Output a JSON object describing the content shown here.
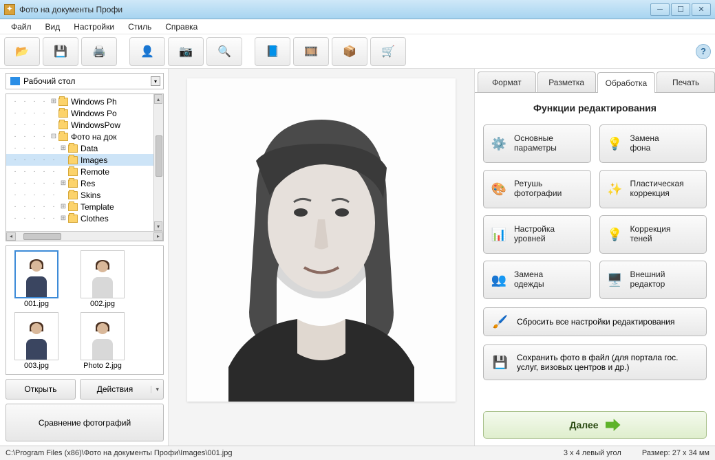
{
  "window": {
    "title": "Фото на документы Профи"
  },
  "menu": {
    "file": "Файл",
    "view": "Вид",
    "settings": "Настройки",
    "style": "Стиль",
    "help": "Справка"
  },
  "toolbar": {
    "new": "new-doc",
    "save": "save",
    "print": "print",
    "profile": "profile",
    "camera": "camera",
    "zoom": "zoom",
    "book": "book",
    "film": "film",
    "box": "box",
    "cart": "cart",
    "help": "?"
  },
  "left": {
    "combo_label": "Рабочий стол",
    "tree": [
      {
        "indent": 5,
        "exp": "⊞",
        "label": "Windows Ph"
      },
      {
        "indent": 5,
        "exp": "",
        "label": "Windows Po"
      },
      {
        "indent": 5,
        "exp": "",
        "label": "WindowsPow"
      },
      {
        "indent": 5,
        "exp": "⊟",
        "label": "Фото на док"
      },
      {
        "indent": 6,
        "exp": "⊞",
        "label": "Data"
      },
      {
        "indent": 6,
        "exp": "",
        "label": "Images",
        "sel": true
      },
      {
        "indent": 6,
        "exp": "",
        "label": "Remote"
      },
      {
        "indent": 6,
        "exp": "⊞",
        "label": "Res"
      },
      {
        "indent": 6,
        "exp": "",
        "label": "Skins"
      },
      {
        "indent": 6,
        "exp": "⊞",
        "label": "Template"
      },
      {
        "indent": 6,
        "exp": "⊞",
        "label": "Clothes"
      }
    ],
    "thumbs": [
      {
        "name": "001.jpg",
        "sel": true
      },
      {
        "name": "002.jpg"
      },
      {
        "name": "003.jpg"
      },
      {
        "name": "Photo 2.jpg"
      }
    ],
    "open": "Открыть",
    "actions": "Действия",
    "compare": "Сравнение фотографий"
  },
  "tabs": {
    "format": "Формат",
    "layout": "Разметка",
    "process": "Обработка",
    "print": "Печать"
  },
  "panel": {
    "title": "Функции редактирования",
    "fns": [
      {
        "id": "basic",
        "label": "Основные\nпараметры",
        "icon": "⚙️",
        "color": "#2a7ac2"
      },
      {
        "id": "bg",
        "label": "Замена\nфона",
        "icon": "💡",
        "color": "#c9403a"
      },
      {
        "id": "retouch",
        "label": "Ретушь\nфотографии",
        "icon": "🎨",
        "color": "#c98b2a"
      },
      {
        "id": "plastic",
        "label": "Пластическая\nкоррекция",
        "icon": "✨",
        "color": "#c9a52a"
      },
      {
        "id": "levels",
        "label": "Настройка\nуровней",
        "icon": "📊",
        "color": "#3aa23a"
      },
      {
        "id": "shadow",
        "label": "Коррекция\nтеней",
        "icon": "💡",
        "color": "#d8b82a"
      },
      {
        "id": "clothes",
        "label": "Замена\nодежды",
        "icon": "👥",
        "color": "#3a8a3a"
      },
      {
        "id": "ext",
        "label": "Внешний\nредактор",
        "icon": "🖥️",
        "color": "#2a6ac2"
      }
    ],
    "reset": "Сбросить все настройки редактирования",
    "save": "Сохранить фото в файл (для портала гос. услуг, визовых центров и др.)",
    "next": "Далее"
  },
  "status": {
    "path": "C:\\Program Files (x86)\\Фото на документы Профи\\Images\\001.jpg",
    "grid": "3 x 4 левый угол",
    "size": "Размер: 27 x 34 мм"
  }
}
